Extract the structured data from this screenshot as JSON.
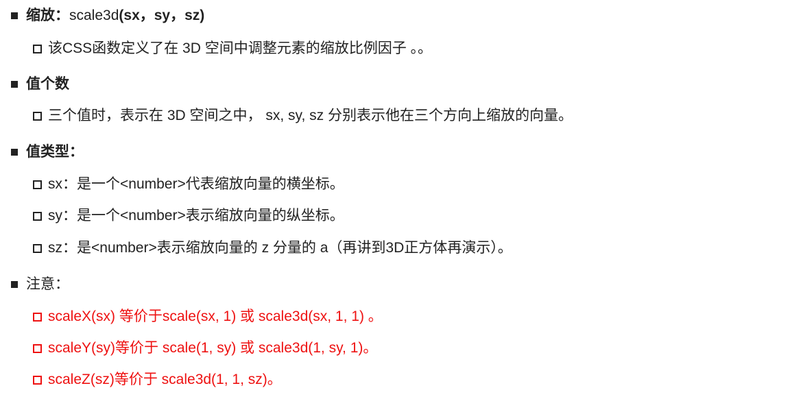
{
  "sections": [
    {
      "heading_bold": "缩放",
      "heading_colon": "：",
      "heading_func": "scale3d",
      "heading_args": "(sx，sy，sz)",
      "items": [
        "该CSS函数定义了在 3D 空间中调整元素的缩放比例因子 。。"
      ]
    },
    {
      "heading_bold": "值个数",
      "items": [
        "三个值时，表示在 3D 空间之中， sx, sy, sz 分别表示他在三个方向上缩放的向量。"
      ]
    },
    {
      "heading_bold": "值类型",
      "heading_colon": "：",
      "items": [
        "sx：是一个<number>代表缩放向量的横坐标。",
        "sy：是一个<number>表示缩放向量的纵坐标。",
        "sz：是<number>表示缩放向量的 z 分量的 a（再讲到3D正方体再演示）。"
      ]
    },
    {
      "heading": "注意：",
      "items": [
        "scaleX(sx) 等价于scale(sx, 1)  或  scale3d(sx, 1, 1) 。",
        "scaleY(sy)等价于 scale(1, sy) 或 scale3d(1, sy, 1)。",
        "scaleZ(sz)等价于 scale3d(1, 1, sz)。"
      ]
    }
  ],
  "colors": {
    "text": "#222222",
    "note": "#ee1111"
  }
}
